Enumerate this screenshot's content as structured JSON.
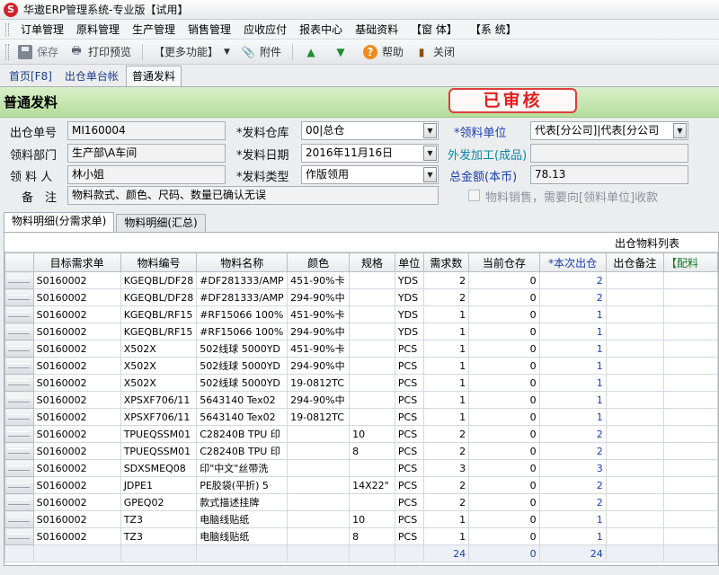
{
  "window": {
    "title": "华遨ERP管理系统-专业版【试用】"
  },
  "menu": [
    "订单管理",
    "原料管理",
    "生产管理",
    "销售管理",
    "应收应付",
    "报表中心",
    "基础资料",
    "【窗 体】",
    "【系 统】"
  ],
  "toolbar": {
    "save": "保存",
    "print_preview": "打印预览",
    "more": "【更多功能】",
    "attach": "附件",
    "help": "帮助",
    "close": "关闭"
  },
  "doc_tabs": [
    "首页[F8]",
    "出仓单台帐",
    "普通发料"
  ],
  "form": {
    "title": "普通发料",
    "status": "已审核",
    "labels": {
      "out_no": "出仓单号",
      "dept": "领料部门",
      "person": "领 料 人",
      "remark": "备　注",
      "warehouse": "*发料仓库",
      "date": "*发料日期",
      "type": "*发料类型",
      "unit": "*领料单位",
      "outsource": "外发加工(成品)",
      "total": "总金额(本币)",
      "sale_check": "物料销售，需要向[领料单位]收款"
    },
    "values": {
      "out_no": "MI160004",
      "dept": "生产部\\A车间",
      "person": "林小姐",
      "remark": "物料款式、颜色、尺码、数量已确认无误",
      "warehouse": "00|总仓",
      "date": "2016年11月16日",
      "type": "作版领用",
      "unit": "代表[分公司]|代表[分公司",
      "outsource": "",
      "total": "78.13"
    }
  },
  "sub_tabs": [
    "物料明细(分需求单)",
    "物料明细(汇总)"
  ],
  "grid": {
    "caption": "出仓物料列表",
    "columns": [
      "目标需求单",
      "物料编号",
      "物料名称",
      "颜色",
      "规格",
      "单位",
      "需求数",
      "当前仓存",
      "*本次出仓",
      "出仓备注",
      "【配料"
    ],
    "rows": [
      [
        "S0160002",
        "KGEQBL/DF28",
        "#DF281333/AMP",
        "451-90%卡",
        "",
        "YDS",
        "2",
        "0",
        "2",
        ""
      ],
      [
        "S0160002",
        "KGEQBL/DF28",
        "#DF281333/AMP",
        "294-90%中",
        "",
        "YDS",
        "2",
        "0",
        "2",
        ""
      ],
      [
        "S0160002",
        "KGEQBL/RF15",
        "#RF15066 100%",
        "451-90%卡",
        "",
        "YDS",
        "1",
        "0",
        "1",
        ""
      ],
      [
        "S0160002",
        "KGEQBL/RF15",
        "#RF15066 100%",
        "294-90%中",
        "",
        "YDS",
        "1",
        "0",
        "1",
        ""
      ],
      [
        "S0160002",
        "X502X",
        "502线球 5000YD",
        "451-90%卡",
        "",
        "PCS",
        "1",
        "0",
        "1",
        ""
      ],
      [
        "S0160002",
        "X502X",
        "502线球 5000YD",
        "294-90%中",
        "",
        "PCS",
        "1",
        "0",
        "1",
        ""
      ],
      [
        "S0160002",
        "X502X",
        "502线球 5000YD",
        "19-0812TC",
        "",
        "PCS",
        "1",
        "0",
        "1",
        ""
      ],
      [
        "S0160002",
        "XPSXF706/11",
        "5643140  Tex02",
        "294-90%中",
        "",
        "PCS",
        "1",
        "0",
        "1",
        ""
      ],
      [
        "S0160002",
        "XPSXF706/11",
        "5643140  Tex02",
        "19-0812TC",
        "",
        "PCS",
        "1",
        "0",
        "1",
        ""
      ],
      [
        "S0160002",
        "TPUEQSSM01",
        "C28240B TPU 印",
        "",
        "10",
        "PCS",
        "2",
        "0",
        "2",
        ""
      ],
      [
        "S0160002",
        "TPUEQSSM01",
        "C28240B TPU 印",
        "",
        "8",
        "PCS",
        "2",
        "0",
        "2",
        ""
      ],
      [
        "S0160002",
        "SDXSMEQ08",
        "印\"中文\"丝带洗",
        "",
        "",
        "PCS",
        "3",
        "0",
        "3",
        ""
      ],
      [
        "S0160002",
        "JDPE1",
        "PE胶袋(平折) 5",
        "",
        "14X22\"",
        "PCS",
        "2",
        "0",
        "2",
        ""
      ],
      [
        "S0160002",
        "GPEQ02",
        "款式描述挂牌",
        "",
        "",
        "PCS",
        "2",
        "0",
        "2",
        ""
      ],
      [
        "S0160002",
        "TZ3",
        "电脑线贴纸",
        "",
        "10",
        "PCS",
        "1",
        "0",
        "1",
        ""
      ],
      [
        "S0160002",
        "TZ3",
        "电脑线贴纸",
        "",
        "8",
        "PCS",
        "1",
        "0",
        "1",
        ""
      ]
    ],
    "totals": {
      "demand": "24",
      "stock": "0",
      "out": "24"
    }
  }
}
